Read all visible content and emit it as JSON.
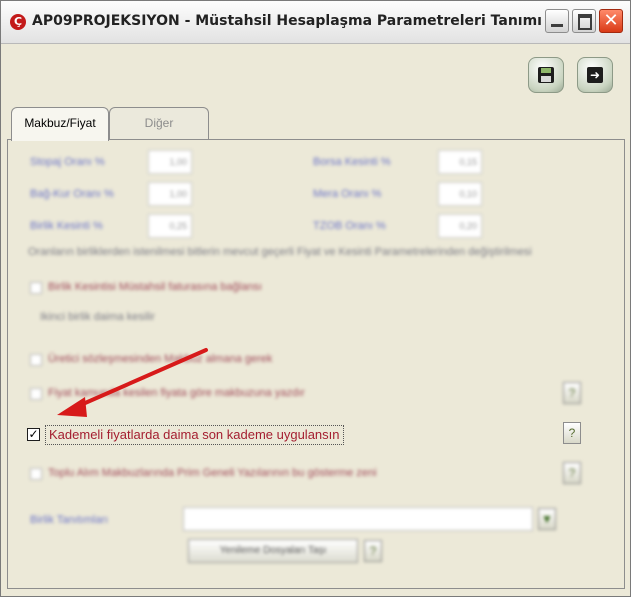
{
  "window": {
    "title": "AP09PROJEKSIYON - Müstahsil Hesaplaşma Parametreleri Tanımı",
    "app_icon_glyph": "Ç",
    "close_glyph": "✕"
  },
  "toolbar": {
    "save_icon": "save-icon",
    "exit_icon": "exit-icon",
    "exit_glyph": "➜"
  },
  "tabs": [
    {
      "label": "Makbuz/Fiyat",
      "active": true
    },
    {
      "label": "Diğer",
      "active": false
    }
  ],
  "form": {
    "blurred_rows": [
      {
        "left_label": "Stopaj Oranı %",
        "left_value": "1,00",
        "right_label": "Borsa Kesinti %",
        "right_value": "0,15"
      },
      {
        "left_label": "Bağ-Kur Oranı %",
        "left_value": "1,00",
        "right_label": "Mera Oranı %",
        "right_value": "0,10"
      },
      {
        "left_label": "Birlik Kesinti %",
        "left_value": "0,25",
        "right_label": "TZOB Oranı %",
        "right_value": "0,20"
      }
    ],
    "info_text": "Oranların birliklerden istenilmesi bitlerin mevcut geçerli Fiyat ve Kesinti Parametrelerinden değiştirilmesi",
    "blurred_option_1": "Birlik Kesintisi Müstahsil faturasına bağlansı",
    "blurred_sub_label": "Ikinci birlik daima kesilir",
    "blurred_option_2": "Üretici sözleşmesinden Makbuz almana gerek",
    "blurred_option_3": "Fiyat kamunda kesilen fiyata göre makbuzuna yazdır",
    "main_option": {
      "label": "Kademeli fiyatlarda daima son kademe uygulansın",
      "checked": true,
      "check_glyph": "✓"
    },
    "help_glyph": "?",
    "blurred_option_4": "Toplu Alım Makbuzlarında Prim Geneli Yazılarının bu gösterme zeni",
    "blurred_dropdown_label": "Birlik Tanıtımları",
    "blurred_button_label": "Yenileme Dosyaları Taşı",
    "dropdown_glyph": "▼"
  },
  "colors": {
    "main_label": "#a41e30",
    "arrow": "#d71a1a"
  }
}
